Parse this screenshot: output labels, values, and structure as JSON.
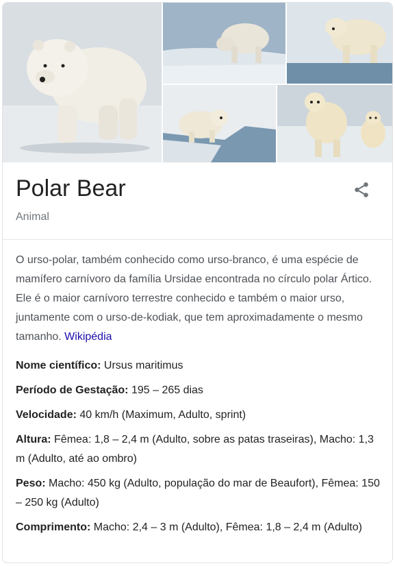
{
  "entity": {
    "title": "Polar Bear",
    "subtitle": "Animal"
  },
  "images": [
    {
      "name": "polar-bear-photo-main"
    },
    {
      "name": "polar-bear-photo-2"
    },
    {
      "name": "polar-bear-photo-3"
    },
    {
      "name": "polar-bear-photo-4"
    },
    {
      "name": "polar-bear-photo-5"
    }
  ],
  "icons": {
    "share": "share-icon"
  },
  "colors": {
    "link": "#1a0dab",
    "text": "#222222",
    "muted": "#70757a",
    "body": "#4d5156"
  },
  "description": {
    "text": "O urso-polar, também conhecido como urso-branco, é uma espécie de mamífero carnívoro da família Ursidae encontrada no círculo polar Ártico. Ele é o maior carnívoro terrestre conhecido e também o maior urso, juntamente com o urso-de-kodiak, que tem aproximadamente o mesmo tamanho.",
    "source_link": "Wikipédia"
  },
  "facts": [
    {
      "label": "Nome científico:",
      "value": "Ursus maritimus"
    },
    {
      "label": "Período de Gestação:",
      "value": "195 – 265 dias"
    },
    {
      "label": "Velocidade:",
      "value": "40 km/h (Maximum, Adulto, sprint)"
    },
    {
      "label": "Altura:",
      "value": "Fêmea: 1,8 – 2,4 m (Adulto, sobre as patas traseiras), Macho: 1,3 m (Adulto, até ao ombro)"
    },
    {
      "label": "Peso:",
      "value": "Macho: 450 kg (Adulto, população do mar de Beaufort), Fêmea: 150 – 250 kg (Adulto)"
    },
    {
      "label": "Comprimento:",
      "value": "Macho: 2,4 – 3 m (Adulto), Fêmea: 1,8 – 2,4 m (Adulto)"
    }
  ]
}
